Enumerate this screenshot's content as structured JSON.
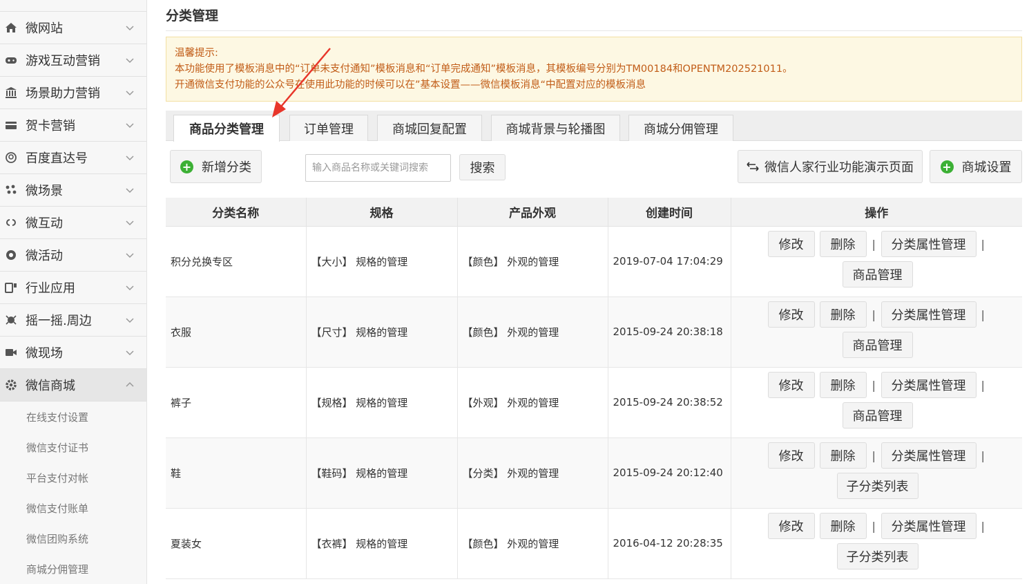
{
  "sidebar": {
    "items": [
      {
        "label": "微网站",
        "icon": "home-icon"
      },
      {
        "label": "游戏互动营销",
        "icon": "gamepad-icon"
      },
      {
        "label": "场景助力营销",
        "icon": "bank-icon"
      },
      {
        "label": "贺卡营销",
        "icon": "card-icon"
      },
      {
        "label": "百度直达号",
        "icon": "baidu-icon"
      },
      {
        "label": "微场景",
        "icon": "scene-icon"
      },
      {
        "label": "微互动",
        "icon": "link-icon"
      },
      {
        "label": "微活动",
        "icon": "activity-icon"
      },
      {
        "label": "行业应用",
        "icon": "apps-icon"
      },
      {
        "label": "摇一摇.周边",
        "icon": "shake-icon"
      },
      {
        "label": "微现场",
        "icon": "video-icon"
      },
      {
        "label": "微信商城",
        "icon": "gear-icon"
      }
    ],
    "subitems": [
      "在线支付设置",
      "微信支付证书",
      "平台支付对帐",
      "微信支付账单",
      "微信团购系统",
      "商城分佣管理"
    ]
  },
  "page": {
    "title": "分类管理",
    "notice": {
      "line1": "温馨提示:",
      "line2": "本功能使用了模板消息中的“订单未支付通知”模板消息和“订单完成通知”模板消息，其模板编号分别为TM00184和OPENTM202521011。",
      "line3": "开通微信支付功能的公众号在使用此功能的时候可以在”基本设置——微信模板消息“中配置对应的模板消息"
    }
  },
  "tabs": [
    "商品分类管理",
    "订单管理",
    "商城回复配置",
    "商城背景与轮播图",
    "商城分佣管理"
  ],
  "toolbar": {
    "add_label": "新增分类",
    "search_placeholder": "输入商品名称或关键词搜索",
    "search_label": "搜索",
    "demo_label": "微信人家行业功能演示页面",
    "settings_label": "商城设置"
  },
  "table": {
    "headers": [
      "分类名称",
      "规格",
      "产品外观",
      "创建时间",
      "操作"
    ],
    "rows": [
      {
        "name": "积分兑换专区",
        "spec": "【大小】  规格的管理",
        "look": "【颜色】  外观的管理",
        "time": "2019-07-04 17:04:29",
        "last": "商品管理"
      },
      {
        "name": "衣服",
        "spec": "【尺寸】  规格的管理",
        "look": "【颜色】  外观的管理",
        "time": "2015-09-24 20:38:18",
        "last": "商品管理"
      },
      {
        "name": "裤子",
        "spec": "【规格】  规格的管理",
        "look": "【外观】  外观的管理",
        "time": "2015-09-24 20:38:52",
        "last": "商品管理"
      },
      {
        "name": "鞋",
        "spec": "【鞋码】  规格的管理",
        "look": "【分类】  外观的管理",
        "time": "2015-09-24 20:12:40",
        "last": "子分类列表"
      },
      {
        "name": "夏装女",
        "spec": "【衣裤】  规格的管理",
        "look": "【颜色】  外观的管理",
        "time": "2016-04-12 20:28:35",
        "last": "子分类列表"
      }
    ],
    "ops": {
      "edit": "修改",
      "delete": "删除",
      "attr": "分类属性管理",
      "sep": "|"
    }
  },
  "colors": {
    "notice_text": "#c15c17",
    "notice_bg": "#fdf8e3",
    "plus_green": "#3cb035",
    "arrow_red": "#e8362a"
  }
}
